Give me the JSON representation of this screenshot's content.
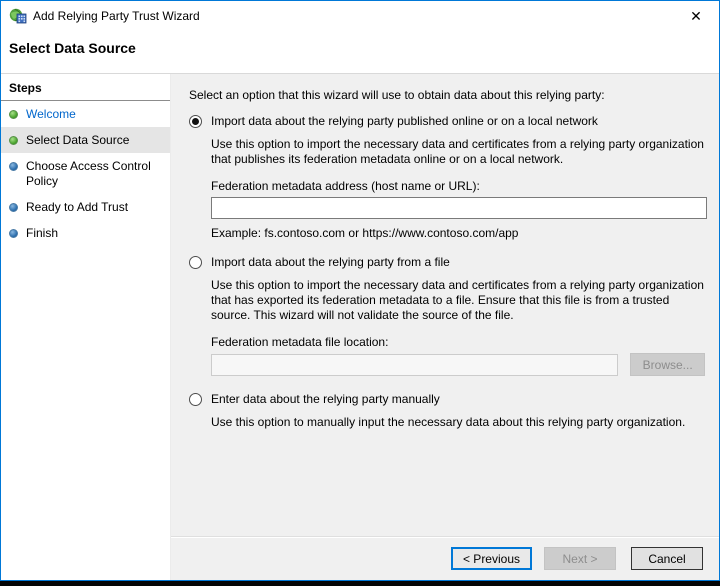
{
  "window": {
    "title": "Add Relying Party Trust Wizard",
    "close_glyph": "✕"
  },
  "page": {
    "heading": "Select Data Source"
  },
  "sidebar": {
    "heading": "Steps",
    "items": [
      {
        "label": "Welcome",
        "bullet": "green",
        "state": "completed-link"
      },
      {
        "label": "Select Data Source",
        "bullet": "green",
        "state": "current"
      },
      {
        "label": "Choose Access Control Policy",
        "bullet": "blue",
        "state": "pending"
      },
      {
        "label": "Ready to Add Trust",
        "bullet": "blue",
        "state": "pending"
      },
      {
        "label": "Finish",
        "bullet": "blue",
        "state": "pending"
      }
    ]
  },
  "main": {
    "intro": "Select an option that this wizard will use to obtain data about this relying party:",
    "options": [
      {
        "label": "Import data about the relying party published online or on a local network",
        "selected": true,
        "description": "Use this option to import the necessary data and certificates from a relying party organization that publishes its federation metadata online or on a local network.",
        "field_label": "Federation metadata address (host name or URL):",
        "field_value": "",
        "example": "Example: fs.contoso.com or https://www.contoso.com/app"
      },
      {
        "label": "Import data about the relying party from a file",
        "selected": false,
        "description": "Use this option to import the necessary data and certificates from a relying party organization that has exported its federation metadata to a file. Ensure that this file is from a trusted source.  This wizard will not validate the source of the file.",
        "field_label": "Federation metadata file location:",
        "field_value": "",
        "field_disabled": true,
        "browse_label": "Browse..."
      },
      {
        "label": "Enter data about the relying party manually",
        "selected": false,
        "description": "Use this option to manually input the necessary data about this relying party organization."
      }
    ]
  },
  "footer": {
    "previous_label": "< Previous",
    "next_label": "Next >",
    "next_disabled": true,
    "cancel_label": "Cancel"
  },
  "colors": {
    "window_border": "#0078d7",
    "main_background": "#f0f0f0",
    "sidebar_background": "#ffffff",
    "current_step_highlight": "#e5e5e5",
    "link_blue": "#0066cc",
    "completed_bullet_green": "#4aa52e",
    "pending_bullet_blue": "#2d6fae",
    "disabled_text": "#8d8d8d",
    "focus_button_border": "#0078d7"
  }
}
